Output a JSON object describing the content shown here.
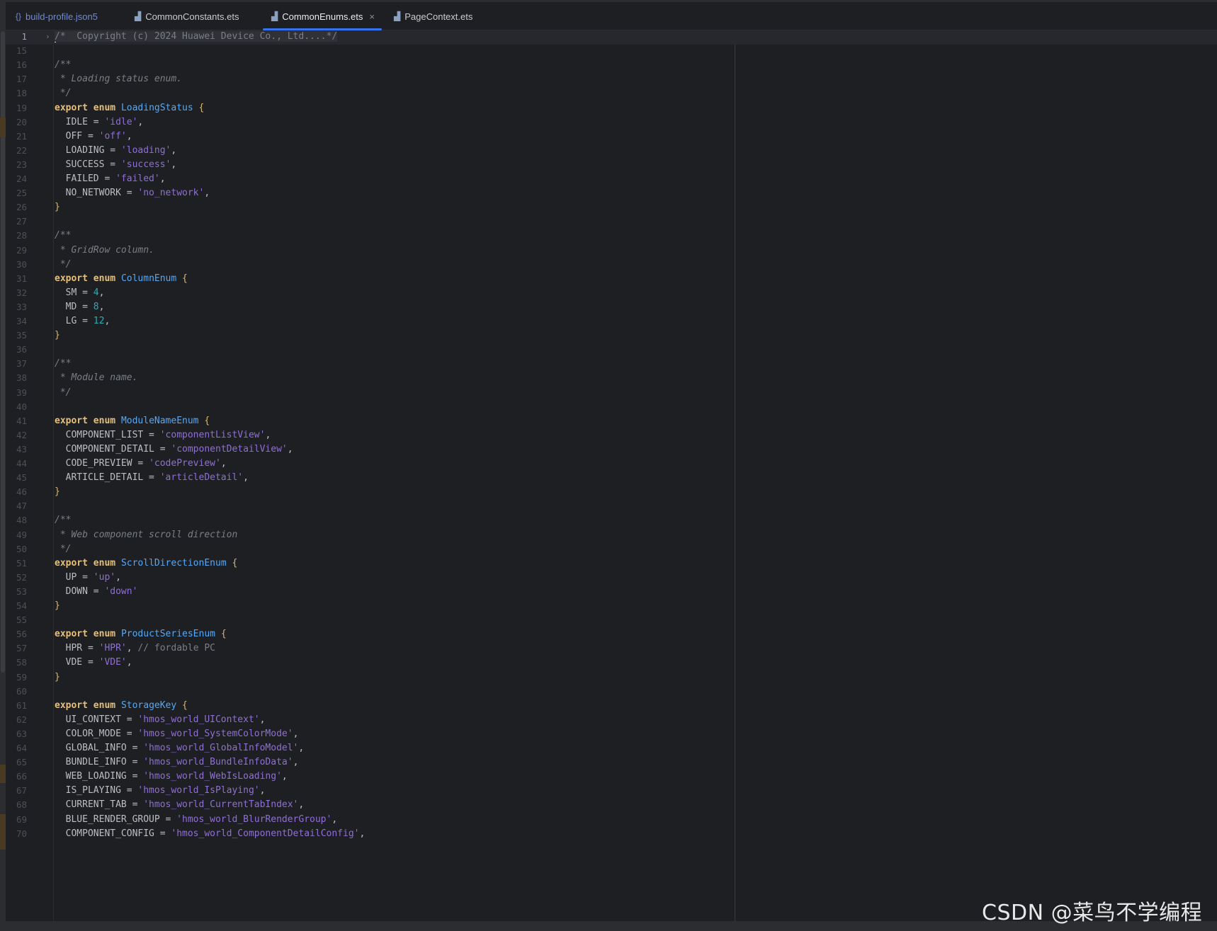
{
  "tabs": [
    {
      "label": "build-profile.json5",
      "icon": "json-braces-icon",
      "active": false
    },
    {
      "label": "CommonConstants.ets",
      "icon": "ets-file-icon",
      "active": false
    },
    {
      "label": "CommonEnums.ets",
      "icon": "ets-file-icon",
      "active": true
    },
    {
      "label": "PageContext.ets",
      "icon": "ets-file-icon",
      "active": false
    }
  ],
  "tab_close_glyph": "×",
  "colors": {
    "background": "#1e1f22",
    "keyword": "#cf8e6d",
    "type_name": "#56a8f5",
    "string": "#8f6fd6",
    "number": "#2aacb8",
    "comment": "#7a7e85",
    "active_tab_underline": "#3574f0"
  },
  "editor": {
    "current_line": 1,
    "lines": [
      {
        "n": "1",
        "fold": "›",
        "tokens": [
          [
            "caret",
            ""
          ],
          [
            "fold",
            "/*  Copyright (c) 2024 Huawei Device Co., Ltd....*/"
          ]
        ]
      },
      {
        "n": "15",
        "tokens": []
      },
      {
        "n": "16",
        "tokens": [
          [
            "cm",
            "/**"
          ]
        ]
      },
      {
        "n": "17",
        "tokens": [
          [
            "cm",
            " * Loading status enum."
          ]
        ]
      },
      {
        "n": "18",
        "tokens": [
          [
            "cm",
            " */"
          ]
        ]
      },
      {
        "n": "19",
        "tokens": [
          [
            "kw",
            "export"
          ],
          [
            "id",
            " "
          ],
          [
            "kw",
            "enum"
          ],
          [
            "id",
            " "
          ],
          [
            "type",
            "LoadingStatus"
          ],
          [
            "id",
            " "
          ],
          [
            "brace",
            "{"
          ]
        ]
      },
      {
        "n": "20",
        "tokens": [
          [
            "id",
            "  IDLE = "
          ],
          [
            "str",
            "'idle'"
          ],
          [
            "punc",
            ","
          ]
        ]
      },
      {
        "n": "21",
        "tokens": [
          [
            "id",
            "  OFF = "
          ],
          [
            "str",
            "'off'"
          ],
          [
            "punc",
            ","
          ]
        ]
      },
      {
        "n": "22",
        "tokens": [
          [
            "id",
            "  LOADING = "
          ],
          [
            "str",
            "'loading'"
          ],
          [
            "punc",
            ","
          ]
        ]
      },
      {
        "n": "23",
        "tokens": [
          [
            "id",
            "  SUCCESS = "
          ],
          [
            "str",
            "'success'"
          ],
          [
            "punc",
            ","
          ]
        ]
      },
      {
        "n": "24",
        "tokens": [
          [
            "id",
            "  FAILED = "
          ],
          [
            "str",
            "'failed'"
          ],
          [
            "punc",
            ","
          ]
        ]
      },
      {
        "n": "25",
        "tokens": [
          [
            "id",
            "  NO_NETWORK = "
          ],
          [
            "str",
            "'no_network'"
          ],
          [
            "punc",
            ","
          ]
        ]
      },
      {
        "n": "26",
        "tokens": [
          [
            "brace",
            "}"
          ]
        ]
      },
      {
        "n": "27",
        "tokens": []
      },
      {
        "n": "28",
        "tokens": [
          [
            "cm",
            "/**"
          ]
        ]
      },
      {
        "n": "29",
        "tokens": [
          [
            "cm",
            " * GridRow column."
          ]
        ]
      },
      {
        "n": "30",
        "tokens": [
          [
            "cm",
            " */"
          ]
        ]
      },
      {
        "n": "31",
        "tokens": [
          [
            "kw",
            "export"
          ],
          [
            "id",
            " "
          ],
          [
            "kw",
            "enum"
          ],
          [
            "id",
            " "
          ],
          [
            "type",
            "ColumnEnum"
          ],
          [
            "id",
            " "
          ],
          [
            "brace",
            "{"
          ]
        ]
      },
      {
        "n": "32",
        "tokens": [
          [
            "id",
            "  SM = "
          ],
          [
            "num",
            "4"
          ],
          [
            "punc",
            ","
          ]
        ]
      },
      {
        "n": "33",
        "tokens": [
          [
            "id",
            "  MD = "
          ],
          [
            "num",
            "8"
          ],
          [
            "punc",
            ","
          ]
        ]
      },
      {
        "n": "34",
        "tokens": [
          [
            "id",
            "  LG = "
          ],
          [
            "num",
            "12"
          ],
          [
            "punc",
            ","
          ]
        ]
      },
      {
        "n": "35",
        "tokens": [
          [
            "brace",
            "}"
          ]
        ]
      },
      {
        "n": "36",
        "tokens": []
      },
      {
        "n": "37",
        "tokens": [
          [
            "cm",
            "/**"
          ]
        ]
      },
      {
        "n": "38",
        "tokens": [
          [
            "cm",
            " * Module name."
          ]
        ]
      },
      {
        "n": "39",
        "tokens": [
          [
            "cm",
            " */"
          ]
        ]
      },
      {
        "n": "40",
        "tokens": []
      },
      {
        "n": "41",
        "tokens": [
          [
            "kw",
            "export"
          ],
          [
            "id",
            " "
          ],
          [
            "kw",
            "enum"
          ],
          [
            "id",
            " "
          ],
          [
            "type",
            "ModuleNameEnum"
          ],
          [
            "id",
            " "
          ],
          [
            "brace",
            "{"
          ]
        ]
      },
      {
        "n": "42",
        "tokens": [
          [
            "id",
            "  COMPONENT_LIST = "
          ],
          [
            "str",
            "'componentListView'"
          ],
          [
            "punc",
            ","
          ]
        ]
      },
      {
        "n": "43",
        "tokens": [
          [
            "id",
            "  COMPONENT_DETAIL = "
          ],
          [
            "str",
            "'componentDetailView'"
          ],
          [
            "punc",
            ","
          ]
        ]
      },
      {
        "n": "44",
        "tokens": [
          [
            "id",
            "  CODE_PREVIEW = "
          ],
          [
            "str",
            "'codePreview'"
          ],
          [
            "punc",
            ","
          ]
        ]
      },
      {
        "n": "45",
        "tokens": [
          [
            "id",
            "  ARTICLE_DETAIL = "
          ],
          [
            "str",
            "'articleDetail'"
          ],
          [
            "punc",
            ","
          ]
        ]
      },
      {
        "n": "46",
        "tokens": [
          [
            "brace",
            "}"
          ]
        ]
      },
      {
        "n": "47",
        "tokens": []
      },
      {
        "n": "48",
        "tokens": [
          [
            "cm",
            "/**"
          ]
        ]
      },
      {
        "n": "49",
        "tokens": [
          [
            "cm",
            " * Web component scroll direction"
          ]
        ]
      },
      {
        "n": "50",
        "tokens": [
          [
            "cm",
            " */"
          ]
        ]
      },
      {
        "n": "51",
        "tokens": [
          [
            "kw",
            "export"
          ],
          [
            "id",
            " "
          ],
          [
            "kw",
            "enum"
          ],
          [
            "id",
            " "
          ],
          [
            "type",
            "ScrollDirectionEnum"
          ],
          [
            "id",
            " "
          ],
          [
            "brace",
            "{"
          ]
        ]
      },
      {
        "n": "52",
        "tokens": [
          [
            "id",
            "  UP = "
          ],
          [
            "str",
            "'up'"
          ],
          [
            "punc",
            ","
          ]
        ]
      },
      {
        "n": "53",
        "tokens": [
          [
            "id",
            "  DOWN = "
          ],
          [
            "str",
            "'down'"
          ]
        ]
      },
      {
        "n": "54",
        "tokens": [
          [
            "brace",
            "}"
          ]
        ]
      },
      {
        "n": "55",
        "tokens": []
      },
      {
        "n": "56",
        "tokens": [
          [
            "kw",
            "export"
          ],
          [
            "id",
            " "
          ],
          [
            "kw",
            "enum"
          ],
          [
            "id",
            " "
          ],
          [
            "type",
            "ProductSeriesEnum"
          ],
          [
            "id",
            " "
          ],
          [
            "brace",
            "{"
          ]
        ]
      },
      {
        "n": "57",
        "tokens": [
          [
            "id",
            "  HPR = "
          ],
          [
            "str",
            "'HPR'"
          ],
          [
            "punc",
            ", "
          ],
          [
            "cmplain",
            "// fordable PC"
          ]
        ]
      },
      {
        "n": "58",
        "tokens": [
          [
            "id",
            "  VDE = "
          ],
          [
            "str",
            "'VDE'"
          ],
          [
            "punc",
            ","
          ]
        ]
      },
      {
        "n": "59",
        "tokens": [
          [
            "brace",
            "}"
          ]
        ]
      },
      {
        "n": "60",
        "tokens": []
      },
      {
        "n": "61",
        "tokens": [
          [
            "kw",
            "export"
          ],
          [
            "id",
            " "
          ],
          [
            "kw",
            "enum"
          ],
          [
            "id",
            " "
          ],
          [
            "type",
            "StorageKey"
          ],
          [
            "id",
            " "
          ],
          [
            "brace",
            "{"
          ]
        ]
      },
      {
        "n": "62",
        "tokens": [
          [
            "id",
            "  UI_CONTEXT = "
          ],
          [
            "str",
            "'hmos_world_UIContext'"
          ],
          [
            "punc",
            ","
          ]
        ]
      },
      {
        "n": "63",
        "tokens": [
          [
            "id",
            "  COLOR_MODE = "
          ],
          [
            "str",
            "'hmos_world_SystemColorMode'"
          ],
          [
            "punc",
            ","
          ]
        ]
      },
      {
        "n": "64",
        "tokens": [
          [
            "id",
            "  GLOBAL_INFO = "
          ],
          [
            "str",
            "'hmos_world_GlobalInfoModel'"
          ],
          [
            "punc",
            ","
          ]
        ]
      },
      {
        "n": "65",
        "tokens": [
          [
            "id",
            "  BUNDLE_INFO = "
          ],
          [
            "str",
            "'hmos_world_BundleInfoData'"
          ],
          [
            "punc",
            ","
          ]
        ]
      },
      {
        "n": "66",
        "tokens": [
          [
            "id",
            "  WEB_LOADING = "
          ],
          [
            "str",
            "'hmos_world_WebIsLoading'"
          ],
          [
            "punc",
            ","
          ]
        ]
      },
      {
        "n": "67",
        "tokens": [
          [
            "id",
            "  IS_PLAYING = "
          ],
          [
            "str",
            "'hmos_world_IsPlaying'"
          ],
          [
            "punc",
            ","
          ]
        ]
      },
      {
        "n": "68",
        "tokens": [
          [
            "id",
            "  CURRENT_TAB = "
          ],
          [
            "str",
            "'hmos_world_CurrentTabIndex'"
          ],
          [
            "punc",
            ","
          ]
        ]
      },
      {
        "n": "69",
        "tokens": [
          [
            "id",
            "  BLUE_RENDER_GROUP = "
          ],
          [
            "str",
            "'hmos_world_BlurRenderGroup'"
          ],
          [
            "punc",
            ","
          ]
        ]
      },
      {
        "n": "70",
        "tokens": [
          [
            "id",
            "  COMPONENT_CONFIG = "
          ],
          [
            "str",
            "'hmos_world_ComponentDetailConfig'"
          ],
          [
            "punc",
            ","
          ]
        ]
      }
    ]
  },
  "watermark": "CSDN @菜鸟不学编程"
}
